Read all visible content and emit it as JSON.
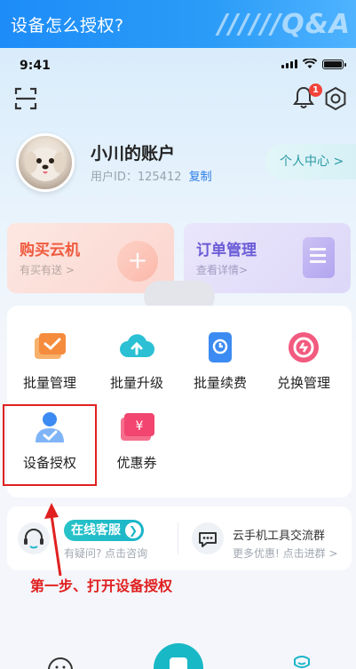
{
  "banner": {
    "title": "设备怎么授权?",
    "logo": "//////Q&A"
  },
  "status_bar": {
    "time": "9:41"
  },
  "header": {
    "notification_count": "1"
  },
  "account": {
    "name": "小川的账户",
    "uid_label": "用户ID：",
    "uid": "125412",
    "copy": "复制",
    "center_button": "个人中心 >"
  },
  "cards": {
    "buy": {
      "title": "购买云机",
      "subtitle": "有买有送 >"
    },
    "order": {
      "title": "订单管理",
      "subtitle": "查看详情>"
    }
  },
  "grid": [
    {
      "label": "批量管理",
      "icon": "batch-manage-icon"
    },
    {
      "label": "批量升级",
      "icon": "cloud-upload-icon"
    },
    {
      "label": "批量续费",
      "icon": "renew-doc-icon"
    },
    {
      "label": "兑换管理",
      "icon": "exchange-icon"
    },
    {
      "label": "设备授权",
      "icon": "device-auth-icon"
    },
    {
      "label": "优惠券",
      "icon": "coupon-icon"
    }
  ],
  "service": {
    "online_label": "在线客服",
    "online_sub": "有疑问? 点击咨询",
    "group_label": "云手机工具交流群",
    "group_sub": "更多优惠! 点击进群 >"
  },
  "instruction": "第一步、打开设备授权",
  "colors": {
    "accent": "#1ab5c9",
    "highlight": "#e02020",
    "banner": "#1d8cf8"
  }
}
